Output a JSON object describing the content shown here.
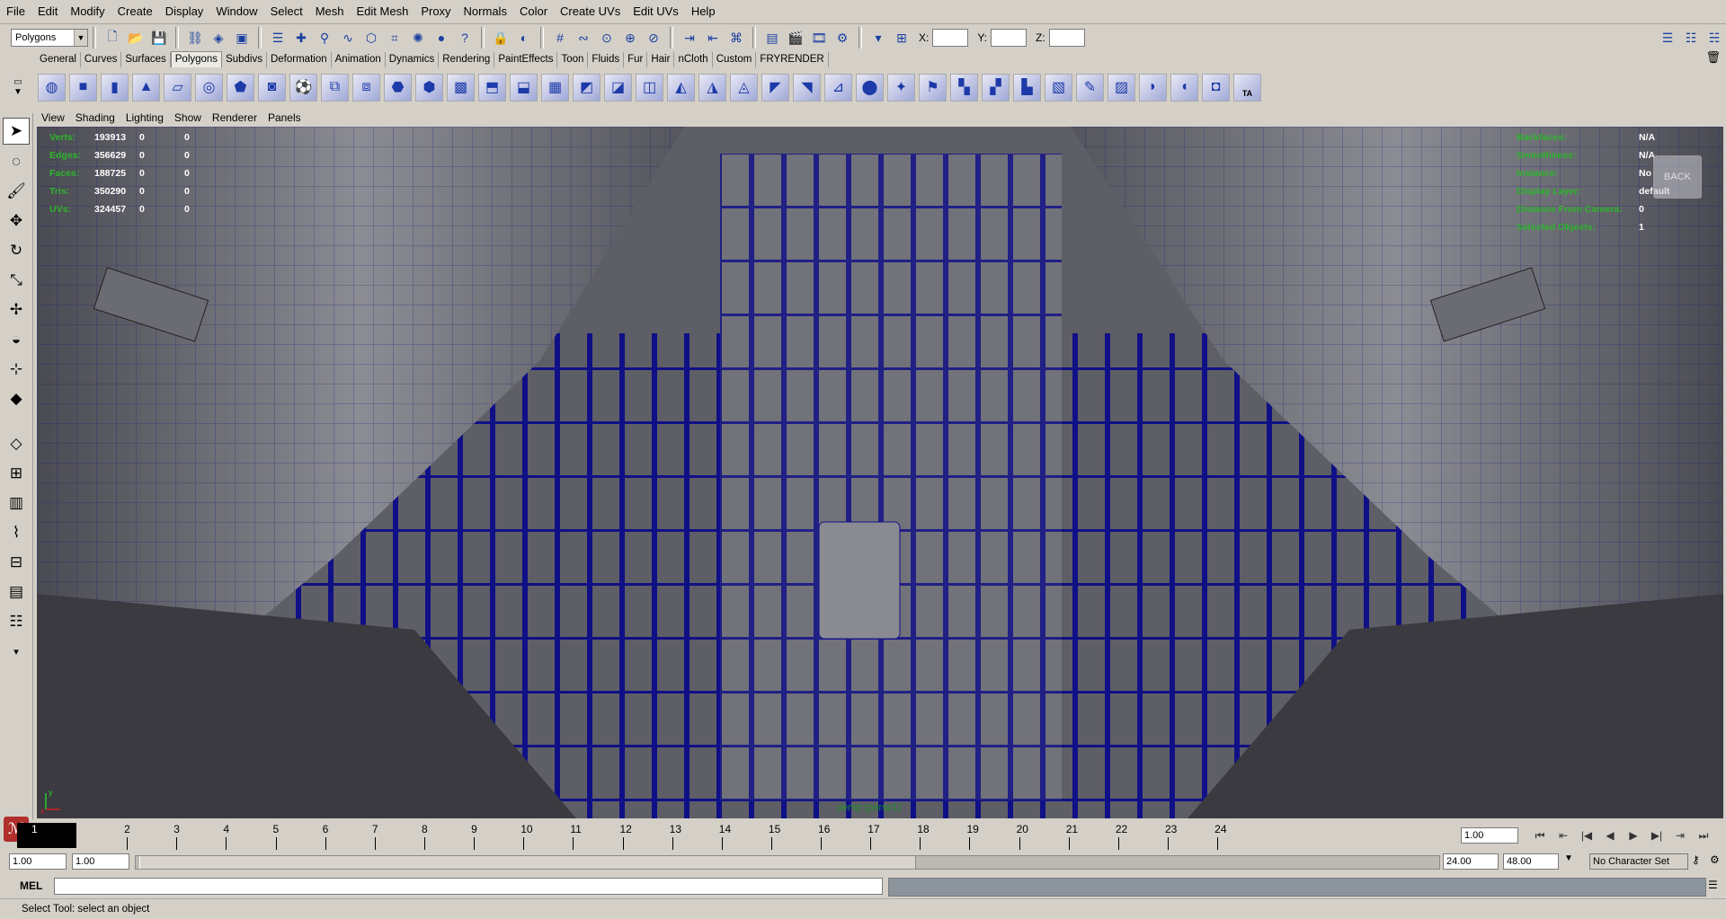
{
  "menubar": [
    "File",
    "Edit",
    "Modify",
    "Create",
    "Display",
    "Window",
    "Select",
    "Mesh",
    "Edit Mesh",
    "Proxy",
    "Normals",
    "Color",
    "Create UVs",
    "Edit UVs",
    "Help"
  ],
  "statusline": {
    "menuset": "Polygons",
    "x_label": "X:",
    "y_label": "Y:",
    "z_label": "Z:"
  },
  "shelf_tabs": [
    "General",
    "Curves",
    "Surfaces",
    "Polygons",
    "Subdivs",
    "Deformation",
    "Animation",
    "Dynamics",
    "Rendering",
    "PaintEffects",
    "Toon",
    "Fluids",
    "Fur",
    "Hair",
    "nCloth",
    "Custom",
    "FRYRENDER"
  ],
  "active_shelf_tab": "Polygons",
  "shelf_last_icon_text": "TA",
  "panel_menu": [
    "View",
    "Shading",
    "Lighting",
    "Show",
    "Renderer",
    "Panels"
  ],
  "hud_left": [
    {
      "label": "Verts:",
      "v1": "193913",
      "v2": "0",
      "v3": "0"
    },
    {
      "label": "Edges:",
      "v1": "356629",
      "v2": "0",
      "v3": "0"
    },
    {
      "label": "Faces:",
      "v1": "188725",
      "v2": "0",
      "v3": "0"
    },
    {
      "label": "Tris:",
      "v1": "350290",
      "v2": "0",
      "v3": "0"
    },
    {
      "label": "UVs:",
      "v1": "324457",
      "v2": "0",
      "v3": "0"
    }
  ],
  "hud_right": [
    {
      "label": "Backfaces:",
      "value": "N/A"
    },
    {
      "label": "Smoothness:",
      "value": "N/A"
    },
    {
      "label": "Instance:",
      "value": "No"
    },
    {
      "label": "Display Layer:",
      "value": "default"
    },
    {
      "label": "Distance From Camera:",
      "value": "0"
    },
    {
      "label": "Selected Objects:",
      "value": "1"
    }
  ],
  "viewcube_label": "BACK",
  "camera_name": "persp (persp1)",
  "axis": {
    "y": "y",
    "x": "x"
  },
  "timeslider": {
    "ticks": [
      "1",
      "2",
      "3",
      "4",
      "5",
      "6",
      "7",
      "8",
      "9",
      "10",
      "11",
      "12",
      "13",
      "14",
      "15",
      "16",
      "17",
      "18",
      "19",
      "20",
      "21",
      "22",
      "23",
      "24"
    ],
    "current_frame": "1",
    "current_time_field": "1.00"
  },
  "rangeslider": {
    "start_time": "1.00",
    "playback_start": "1.00",
    "playback_end": "24.00",
    "end_time": "48.00",
    "character_set": "No Character Set"
  },
  "cmdline": {
    "label": "MEL"
  },
  "helpline": "Select Tool: select an object"
}
